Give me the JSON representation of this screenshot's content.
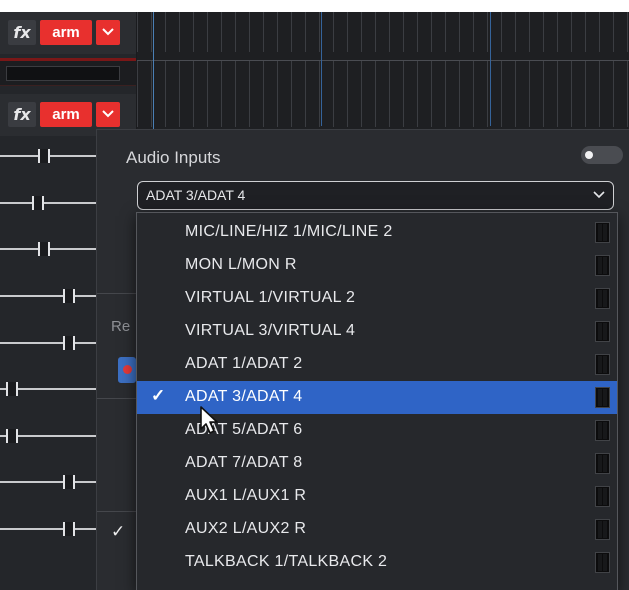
{
  "tracks": [
    {
      "fx_label": "fx",
      "arm_label": "arm"
    },
    {
      "fx_label": "fx",
      "arm_label": "arm"
    }
  ],
  "audio_inputs": {
    "title": "Audio Inputs",
    "enabled": false,
    "selected_value": "ADAT 3/ADAT 4",
    "partial_label": "Re",
    "left_check": "✓"
  },
  "dropdown": {
    "selected_index": 5,
    "check_glyph": "✓",
    "options": [
      "MIC/LINE/HIZ 1/MIC/LINE 2",
      "MON L/MON R",
      "VIRTUAL 1/VIRTUAL 2",
      "VIRTUAL 3/VIRTUAL 4",
      "ADAT 1/ADAT 2",
      "ADAT 3/ADAT 4",
      "ADAT 5/ADAT 6",
      "ADAT 7/ADAT 8",
      "AUX1 L/AUX1 R",
      "AUX2 L/AUX2 R",
      "TALKBACK 1/TALKBACK 2"
    ]
  },
  "colors": {
    "arm": "#e8302e",
    "selection": "#2f64c6",
    "background": "#1a1b1e"
  }
}
